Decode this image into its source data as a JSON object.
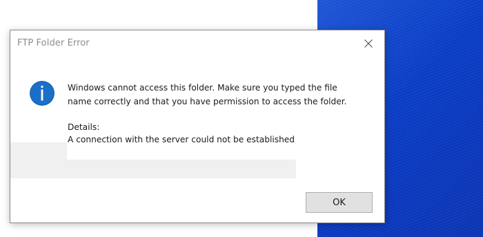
{
  "dialog": {
    "title": "FTP Folder Error",
    "message_line1": "Windows cannot access this folder. Make sure you typed the file",
    "message_line2": "name correctly and that you have permission to access the folder.",
    "details_label": "Details:",
    "details_text": "A connection with the server could not be established",
    "ok_label": "OK",
    "icon": "info-icon",
    "close_icon": "close-icon"
  },
  "colors": {
    "desktop_accent": "#0a3ec9",
    "info_icon_fill": "#1c6fc9",
    "button_face": "#e1e1e1"
  }
}
